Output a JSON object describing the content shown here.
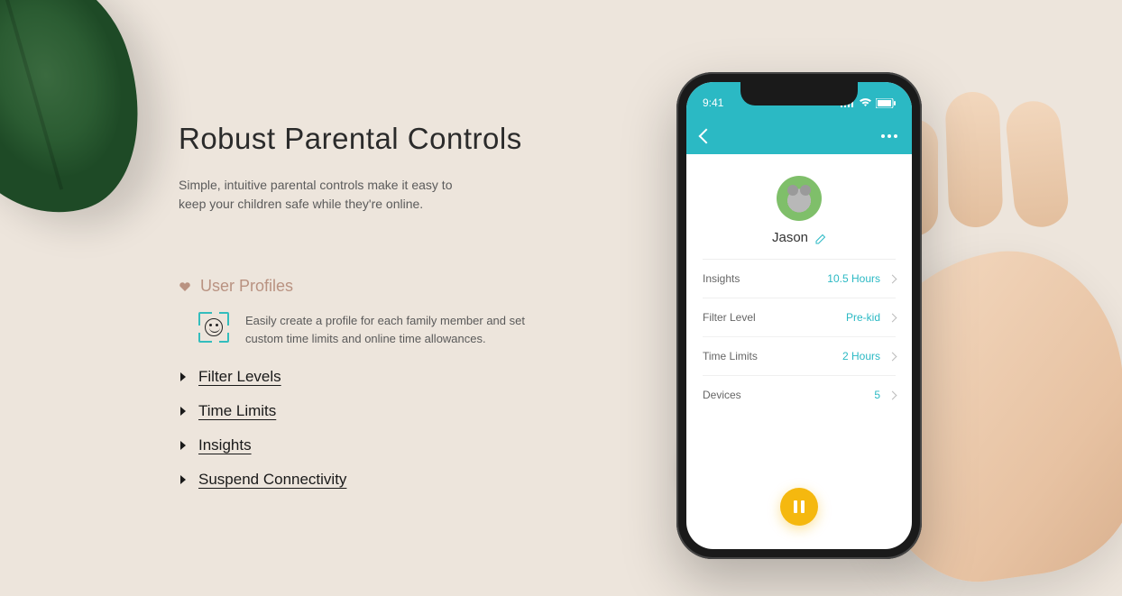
{
  "hero": {
    "title": "Robust Parental Controls",
    "subtitle": "Simple, intuitive parental controls make it easy to keep your children safe while they're online."
  },
  "features": {
    "active_index": 0,
    "items": [
      {
        "label": "User Profiles",
        "detail": "Easily create a profile for each family member and set custom time limits and online time allowances."
      },
      {
        "label": "Filter Levels"
      },
      {
        "label": "Time Limits"
      },
      {
        "label": "Insights"
      },
      {
        "label": "Suspend Connectivity"
      }
    ]
  },
  "phone": {
    "status_time": "9:41",
    "profile_name": "Jason",
    "rows": [
      {
        "label": "Insights",
        "value": "10.5 Hours"
      },
      {
        "label": "Filter Level",
        "value": "Pre-kid"
      },
      {
        "label": "Time Limits",
        "value": "2 Hours"
      },
      {
        "label": "Devices",
        "value": "5"
      }
    ]
  }
}
